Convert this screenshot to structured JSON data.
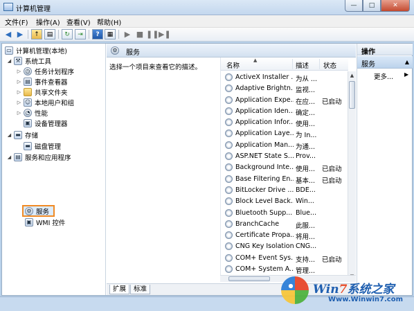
{
  "window": {
    "title": "计算机管理",
    "min_glyph": "—",
    "max_glyph": "□",
    "close_glyph": "✕"
  },
  "menu": [
    "文件(F)",
    "操作(A)",
    "查看(V)",
    "帮助(H)"
  ],
  "tree": {
    "root": "计算机管理(本地)",
    "system_tools": "系统工具",
    "task_scheduler": "任务计划程序",
    "event_viewer": "事件查看器",
    "shared_folders": "共享文件夹",
    "local_users": "本地用户和组",
    "performance": "性能",
    "device_manager": "设备管理器",
    "storage": "存储",
    "disk_management": "磁盘管理",
    "services_apps": "服务和应用程序",
    "services": "服务",
    "wmi": "WMI 控件"
  },
  "center": {
    "title": "服务",
    "description": "选择一个项目来查看它的描述。",
    "columns": {
      "name": "名称",
      "desc": "描述",
      "status": "状态"
    },
    "services": [
      {
        "name": "ActiveX Installer ...",
        "desc": "为从 ...",
        "status": ""
      },
      {
        "name": "Adaptive Brightn...",
        "desc": "监视...",
        "status": ""
      },
      {
        "name": "Application Expe...",
        "desc": "在应...",
        "status": "已启动"
      },
      {
        "name": "Application Iden...",
        "desc": "确定...",
        "status": ""
      },
      {
        "name": "Application Infor...",
        "desc": "使用...",
        "status": ""
      },
      {
        "name": "Application Laye...",
        "desc": "为 In...",
        "status": ""
      },
      {
        "name": "Application Man...",
        "desc": "为通...",
        "status": ""
      },
      {
        "name": "ASP.NET State S...",
        "desc": "Prov...",
        "status": ""
      },
      {
        "name": "Background Inte...",
        "desc": "使用...",
        "status": "已启动"
      },
      {
        "name": "Base Filtering En...",
        "desc": "基本...",
        "status": "已启动"
      },
      {
        "name": "BitLocker Drive ...",
        "desc": "BDE...",
        "status": ""
      },
      {
        "name": "Block Level Back...",
        "desc": "Win...",
        "status": ""
      },
      {
        "name": "Bluetooth Supp...",
        "desc": "Blue...",
        "status": ""
      },
      {
        "name": "BranchCache",
        "desc": "此服...",
        "status": ""
      },
      {
        "name": "Certificate Propa...",
        "desc": "将用...",
        "status": ""
      },
      {
        "name": "CNG Key Isolation",
        "desc": "CNG...",
        "status": ""
      },
      {
        "name": "COM+ Event Sys...",
        "desc": "支持...",
        "status": "已启动"
      },
      {
        "name": "COM+ System A...",
        "desc": "管理...",
        "status": ""
      }
    ],
    "tabs": [
      "扩展",
      "标准"
    ]
  },
  "actions": {
    "header": "操作",
    "section": "服务",
    "more": "更多..."
  },
  "watermark": {
    "logo_prefix": "Win",
    "logo_seven": "7",
    "logo_suffix": "系统之家",
    "url": "Www.Winwin7.com"
  }
}
